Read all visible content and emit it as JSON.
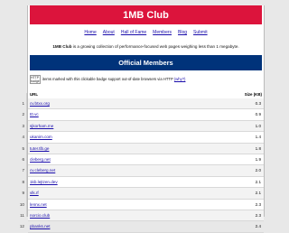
{
  "header": {
    "title": "1MB Club"
  },
  "nav": [
    "Home",
    "About",
    "Hall of Fame",
    "Members",
    "Blog",
    "Submit"
  ],
  "intro": {
    "brand": "1MB Club",
    "text": " is a growing collection of performance-focused web pages weighing less than 1 megabyte."
  },
  "members": {
    "heading": "Official Members",
    "badge_alt": "HTTP badge",
    "badge_note": "items marked with this clickable badge support out-of-date browsers via HTTP",
    "badge_link": "(why?)",
    "col_url": "URL",
    "col_size": "Size (KB)",
    "rows": [
      {
        "n": "1",
        "site": "cv.btxx.org",
        "kb": "0.3"
      },
      {
        "n": "2",
        "site": "t0.vc",
        "kb": "0.9"
      },
      {
        "n": "3",
        "site": "sjkorham.me",
        "kb": "1.0"
      },
      {
        "n": "4",
        "site": "ukanim.com",
        "kb": "1.4"
      },
      {
        "n": "5",
        "site": "tuter.tlb.ge",
        "kb": "1.8"
      },
      {
        "n": "6",
        "site": "cleberg.net",
        "kb": "1.9"
      },
      {
        "n": "7",
        "site": "cv.cleberg.net",
        "kb": "2.0"
      },
      {
        "n": "8",
        "site": "1kb.lejtzen.dev",
        "kb": "2.1"
      },
      {
        "n": "9",
        "site": "vlk.rf",
        "kb": "2.1"
      },
      {
        "n": "10",
        "site": "lennx.net",
        "kb": "2.3"
      },
      {
        "n": "11",
        "site": "norcio.club",
        "kb": "2.3"
      },
      {
        "n": "12",
        "site": "pbanks.net",
        "kb": "2.4"
      }
    ]
  }
}
